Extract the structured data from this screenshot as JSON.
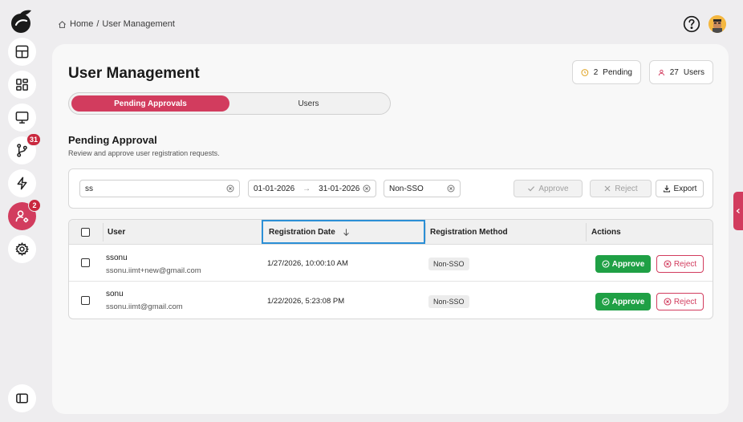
{
  "sidebar": {
    "items": [
      {
        "name": "dashboard",
        "icon": "layout-icon"
      },
      {
        "name": "widgets",
        "icon": "grid-icon"
      },
      {
        "name": "monitor",
        "icon": "monitor-icon"
      },
      {
        "name": "workflows",
        "icon": "branch-icon",
        "badge": "31"
      },
      {
        "name": "automation",
        "icon": "lightning-icon"
      },
      {
        "name": "user-management",
        "icon": "user-gear-icon",
        "badge": "2",
        "active": true
      },
      {
        "name": "settings",
        "icon": "gear-icon"
      }
    ],
    "accent": "#d23c5e"
  },
  "header": {
    "breadcrumb_home": "Home",
    "breadcrumb_sep": "/",
    "breadcrumb_current": "User Management"
  },
  "page": {
    "title": "User Management",
    "stats": {
      "pending_count": "2",
      "pending_label": "Pending",
      "users_count": "27",
      "users_label": "Users"
    },
    "tabs": [
      {
        "label": "Pending Approvals",
        "active": true
      },
      {
        "label": "Users",
        "active": false
      }
    ],
    "section_title": "Pending Approval",
    "section_subtitle": "Review and approve user registration requests."
  },
  "filters": {
    "search_value": "ss",
    "date_from": "01-01-2026",
    "date_arrow": "→",
    "date_to": "31-01-2026",
    "method_value": "Non-SSO",
    "approve_label": "Approve",
    "reject_label": "Reject",
    "export_label": "Export"
  },
  "table": {
    "columns": [
      "User",
      "Registration Date",
      "Registration Method",
      "Actions"
    ],
    "sorted_column": "Registration Date",
    "rows": [
      {
        "name": "ssonu",
        "email": "ssonu.iimt+new@gmail.com",
        "date": "1/27/2026, 10:00:10 AM",
        "method": "Non-SSO",
        "approve_label": "Approve",
        "reject_label": "Reject"
      },
      {
        "name": "sonu",
        "email": "ssonu.iimt@gmail.com",
        "date": "1/22/2026, 5:23:08 PM",
        "method": "Non-SSO",
        "approve_label": "Approve",
        "reject_label": "Reject"
      }
    ]
  },
  "colors": {
    "brand": "#d23c5e",
    "approve": "#1fa045",
    "highlight": "#2b8fd6"
  }
}
